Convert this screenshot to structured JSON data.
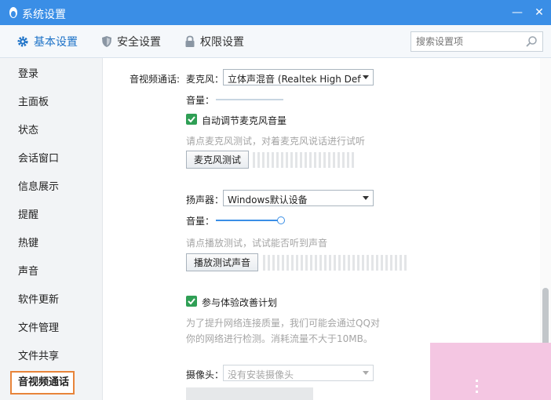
{
  "window": {
    "title": "系统设置"
  },
  "tabs": [
    {
      "label": "基本设置",
      "icon": "gear-icon"
    },
    {
      "label": "安全设置",
      "icon": "shield-icon"
    },
    {
      "label": "权限设置",
      "icon": "lock-icon"
    }
  ],
  "search": {
    "placeholder": "搜索设置项"
  },
  "sidebar": {
    "items": [
      {
        "label": "登录"
      },
      {
        "label": "主面板"
      },
      {
        "label": "状态"
      },
      {
        "label": "会话窗口"
      },
      {
        "label": "信息展示"
      },
      {
        "label": "提醒"
      },
      {
        "label": "热键"
      },
      {
        "label": "声音"
      },
      {
        "label": "软件更新"
      },
      {
        "label": "文件管理"
      },
      {
        "label": "文件共享"
      },
      {
        "label": "音视频通话"
      }
    ],
    "selected": "音视频通话"
  },
  "av": {
    "section_label": "音视频通话:",
    "mic": {
      "label": "麦克风：",
      "device": "立体声混音 (Realtek High Defi...",
      "volume_label": "音量：",
      "volume_level": 0,
      "auto_adjust_label": "自动调节麦克风音量",
      "auto_adjust_checked": true,
      "test_hint": "请点麦克风测试，对着麦克风说话进行试听",
      "test_button": "麦克风测试"
    },
    "speaker": {
      "label": "扬声器：",
      "device": "Windows默认设备",
      "volume_label": "音量：",
      "volume_level": 0.97,
      "test_hint": "请点播放测试，试试能否听到声音",
      "test_button": "播放测试声音"
    },
    "experience": {
      "label": "参与体验改善计划",
      "checked": true,
      "desc_line1": "为了提升网络连接质量，我们可能会通过QQ对",
      "desc_line2": "你的网络进行检测。消耗流量不大于10MB。"
    },
    "camera": {
      "label": "摄像头：",
      "device": "没有安装摄像头"
    }
  },
  "colors": {
    "titlebar": "#3a8ee6",
    "accent": "#1b71c7",
    "check": "#2f9f55",
    "highlight": "#e8843a"
  }
}
